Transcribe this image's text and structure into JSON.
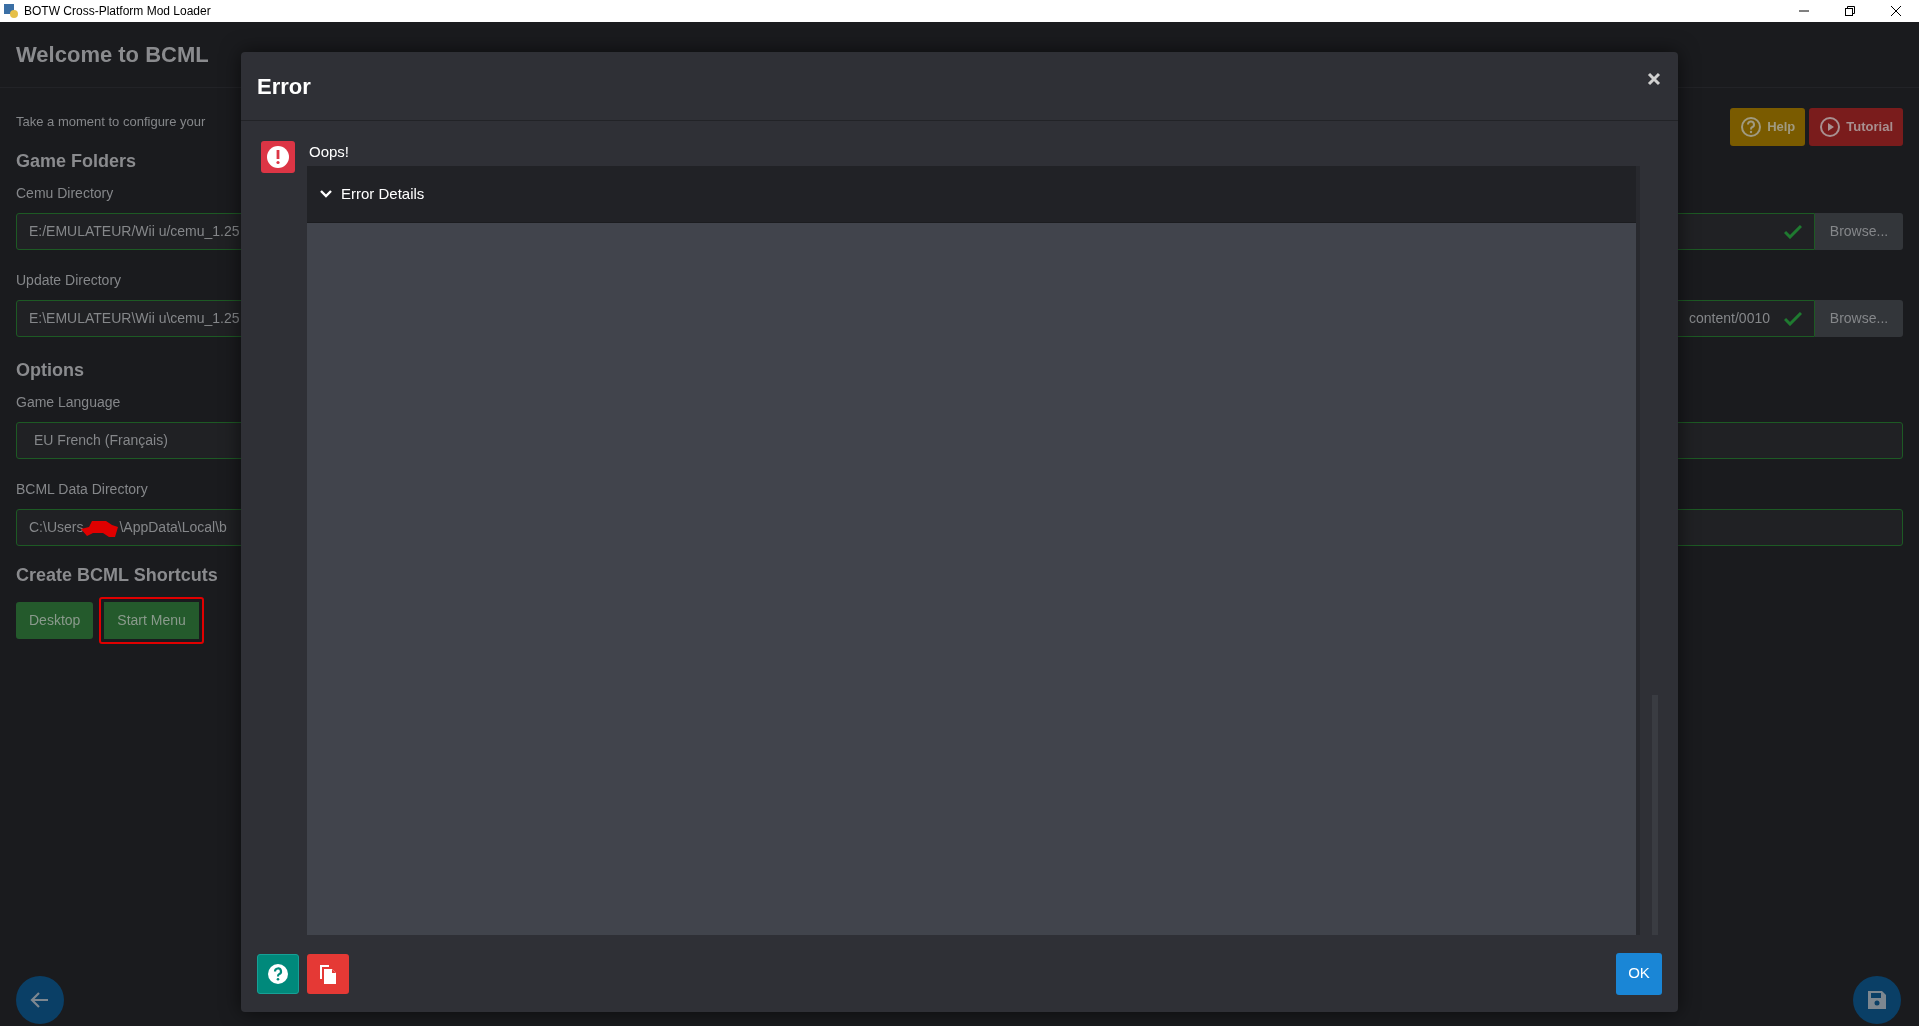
{
  "window": {
    "title": "BOTW Cross-Platform Mod Loader"
  },
  "page": {
    "title": "Welcome to BCML",
    "intro": "Take a moment to configure your",
    "help_button": "Help",
    "tutorial_button": "Tutorial"
  },
  "game_folders": {
    "heading": "Game Folders",
    "fields": [
      {
        "label": "Cemu Directory",
        "value": "E:/EMULATEUR/Wii u/cemu_1.25",
        "valid": true,
        "button": "Browse..."
      },
      {
        "label": "Update Directory",
        "value": "E:\\EMULATEUR\\Wii u\\cemu_1.25",
        "value_end": "content/0010",
        "valid": true,
        "button": "Browse..."
      }
    ]
  },
  "options": {
    "heading": "Options",
    "language_label": "Game Language",
    "language": "EU French (Français)",
    "data_dir_label": "BCML Data Directory",
    "data_dir_start": "C:\\Users",
    "data_dir_end": "\\AppData\\Local\\b"
  },
  "shortcuts": {
    "heading": "Create BCML Shortcuts",
    "buttons": [
      {
        "label": "Desktop",
        "highlighted": false
      },
      {
        "label": "Start Menu",
        "highlighted": true
      }
    ]
  },
  "dialog": {
    "title": "Error",
    "message": "Oops!",
    "details": {
      "label": "Error Details",
      "expanded": true
    },
    "ok_button": "OK"
  }
}
